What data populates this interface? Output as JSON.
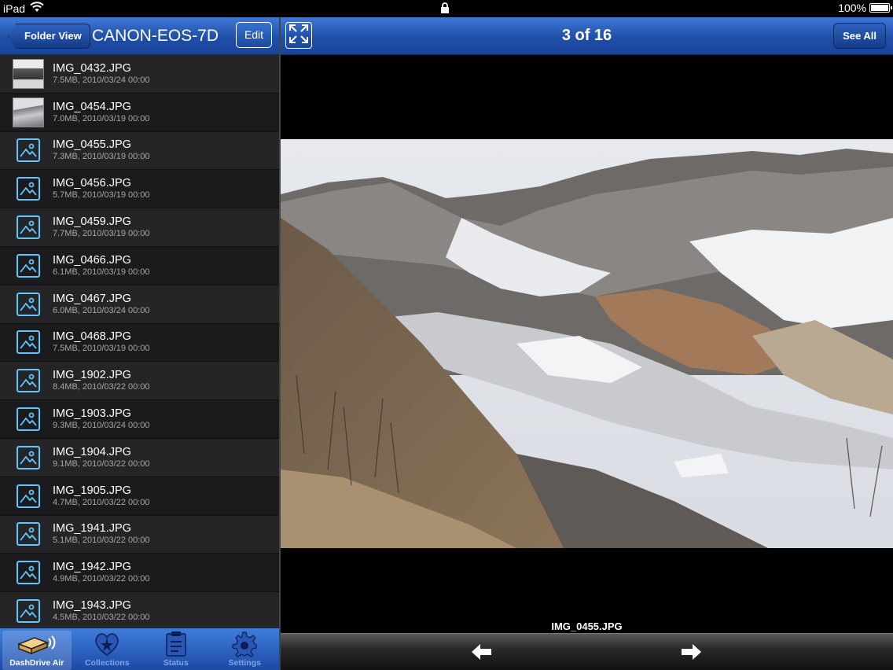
{
  "status_bar": {
    "device": "iPad",
    "battery": "100%"
  },
  "left_nav": {
    "back_label": "Folder View",
    "title": "CANON-EOS-7D",
    "edit_label": "Edit"
  },
  "files": [
    {
      "name": "IMG_0432.JPG",
      "meta": "7.5MB, 2010/03/24 00:00",
      "thumb": "photo"
    },
    {
      "name": "IMG_0454.JPG",
      "meta": "7.0MB, 2010/03/19 00:00",
      "thumb": "photo"
    },
    {
      "name": "IMG_0455.JPG",
      "meta": "7.3MB, 2010/03/19 00:00",
      "thumb": "image-icon"
    },
    {
      "name": "IMG_0456.JPG",
      "meta": "5.7MB, 2010/03/19 00:00",
      "thumb": "image-icon"
    },
    {
      "name": "IMG_0459.JPG",
      "meta": "7.7MB, 2010/03/19 00:00",
      "thumb": "image-icon"
    },
    {
      "name": "IMG_0466.JPG",
      "meta": "6.1MB, 2010/03/19 00:00",
      "thumb": "image-icon"
    },
    {
      "name": "IMG_0467.JPG",
      "meta": "6.0MB, 2010/03/24 00:00",
      "thumb": "image-icon"
    },
    {
      "name": "IMG_0468.JPG",
      "meta": "7.5MB, 2010/03/19 00:00",
      "thumb": "image-icon"
    },
    {
      "name": "IMG_1902.JPG",
      "meta": "8.4MB, 2010/03/22 00:00",
      "thumb": "image-icon"
    },
    {
      "name": "IMG_1903.JPG",
      "meta": "9.3MB, 2010/03/24 00:00",
      "thumb": "image-icon"
    },
    {
      "name": "IMG_1904.JPG",
      "meta": "9.1MB, 2010/03/22 00:00",
      "thumb": "image-icon"
    },
    {
      "name": "IMG_1905.JPG",
      "meta": "4.7MB, 2010/03/22 00:00",
      "thumb": "image-icon"
    },
    {
      "name": "IMG_1941.JPG",
      "meta": "5.1MB, 2010/03/22 00:00",
      "thumb": "image-icon"
    },
    {
      "name": "IMG_1942.JPG",
      "meta": "4.9MB, 2010/03/22 00:00",
      "thumb": "image-icon"
    },
    {
      "name": "IMG_1943.JPG",
      "meta": "4.5MB, 2010/03/22 00:00",
      "thumb": "image-icon"
    }
  ],
  "tabs": [
    {
      "label": "DashDrive Air",
      "icon": "drive-icon",
      "active": true
    },
    {
      "label": "Collections",
      "icon": "heart-star-icon",
      "active": false
    },
    {
      "label": "Status",
      "icon": "clipboard-icon",
      "active": false
    },
    {
      "label": "Settings",
      "icon": "gear-icon",
      "active": false
    }
  ],
  "viewer": {
    "counter": "3 of 16",
    "see_all_label": "See All",
    "caption": "IMG_0455.JPG"
  },
  "colors": {
    "nav_blue": "#1f4fa8",
    "icon_cyan": "#5cc8ff",
    "list_bg": "#1d1d1f"
  }
}
